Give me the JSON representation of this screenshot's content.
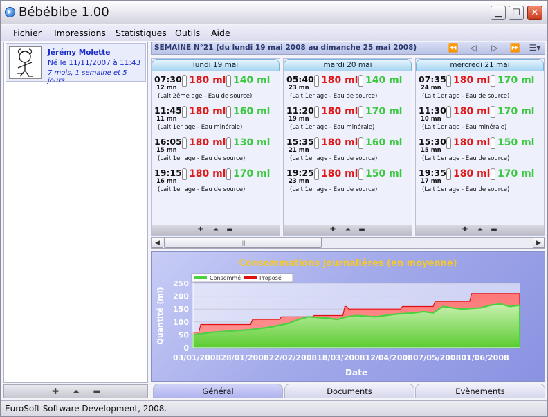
{
  "window": {
    "title": "Bébébibe 1.00",
    "icon": "app-icon"
  },
  "menu": [
    "Fichier",
    "Impressions",
    "Statistiques",
    "Outils",
    "Aide"
  ],
  "profile": {
    "name": "Jérémy Molette",
    "birth": "Né le 11/11/2007 à 11:43",
    "age": "7 mois, 1 semaine et 5 jours"
  },
  "week": {
    "label": "SEMAINE N°21 (du lundi 19 mai 2008 au dimanche 25 mai 2008)"
  },
  "days": [
    {
      "label": "lundi 19 mai",
      "meals": [
        {
          "time": "07:30",
          "duration": "12 mn",
          "proposed": "180 ml",
          "consumed": "140 ml",
          "note": "(Lait 2ème age - Eau de source)"
        },
        {
          "time": "11:45",
          "duration": "11 mn",
          "proposed": "180 ml",
          "consumed": "160 ml",
          "note": "(Lait 1er age - Eau minérale)"
        },
        {
          "time": "16:05",
          "duration": "15 mn",
          "proposed": "180 ml",
          "consumed": "130 ml",
          "note": "(Lait 1er age - Eau de source)"
        },
        {
          "time": "19:15",
          "duration": "16 mn",
          "proposed": "180 ml",
          "consumed": "170 ml",
          "note": "(Lait 1er age - Eau de source)"
        }
      ]
    },
    {
      "label": "mardi 20 mai",
      "meals": [
        {
          "time": "05:40",
          "duration": "23 mn",
          "proposed": "180 ml",
          "consumed": "140 ml",
          "note": "(Lait 1er age - Eau de source)"
        },
        {
          "time": "11:20",
          "duration": "19 mn",
          "proposed": "180 ml",
          "consumed": "170 ml",
          "note": "(Lait 1er age - Eau minérale)"
        },
        {
          "time": "15:35",
          "duration": "21 mn",
          "proposed": "180 ml",
          "consumed": "160 ml",
          "note": "(Lait 1er age - Eau de source)"
        },
        {
          "time": "19:25",
          "duration": "23 mn",
          "proposed": "180 ml",
          "consumed": "150 ml",
          "note": "(Lait 1er age - Eau de source)"
        }
      ]
    },
    {
      "label": "mercredi 21 mai",
      "meals": [
        {
          "time": "07:35",
          "duration": "24 mn",
          "proposed": "180 ml",
          "consumed": "170 ml",
          "note": "(Lait 1er age - Eau de source)"
        },
        {
          "time": "11:30",
          "duration": "10 mn",
          "proposed": "180 ml",
          "consumed": "170 ml",
          "note": "(Lait 1er age - Eau minérale)"
        },
        {
          "time": "15:30",
          "duration": "15 mn",
          "proposed": "180 ml",
          "consumed": "150 ml",
          "note": "(Lait 1er age - Eau de source)"
        },
        {
          "time": "19:35",
          "duration": "17 mn",
          "proposed": "180 ml",
          "consumed": "170 ml",
          "note": "(Lait 1er age - Eau de source)"
        }
      ]
    }
  ],
  "tabs": [
    "Général",
    "Documents",
    "Evènements"
  ],
  "status": "EuroSoft Software Development, 2008.",
  "chart_data": {
    "type": "area",
    "title": "Consommations journalières (en moyenne)",
    "xlabel": "Date",
    "ylabel": "Quantité (ml)",
    "ylim": [
      0,
      250
    ],
    "yticks": [
      0,
      50,
      100,
      150,
      200,
      250
    ],
    "xtick_labels": [
      "03/01/2008",
      "28/01/2008",
      "22/02/2008",
      "18/03/2008",
      "12/04/2008",
      "07/05/2008",
      "01/06/2008"
    ],
    "xtick_days": [
      2,
      27,
      52,
      77,
      102,
      127,
      152
    ],
    "x_range_days": [
      0,
      170
    ],
    "grid": true,
    "legend_position": "top-left",
    "series": [
      {
        "name": "Consommé",
        "color": "#4cd040",
        "x": [
          0,
          5,
          10,
          20,
          30,
          40,
          50,
          55,
          60,
          70,
          75,
          80,
          85,
          95,
          100,
          105,
          115,
          120,
          125,
          130,
          140,
          150,
          155,
          160,
          165,
          170
        ],
        "values": [
          50,
          55,
          60,
          65,
          70,
          80,
          95,
          110,
          120,
          115,
          110,
          120,
          125,
          120,
          125,
          130,
          135,
          140,
          135,
          160,
          150,
          155,
          165,
          170,
          160,
          165
        ]
      },
      {
        "name": "Proposé",
        "color": "#e01010",
        "x": [
          0,
          3,
          4,
          30,
          31,
          45,
          46,
          62,
          63,
          78,
          79,
          80,
          81,
          108,
          109,
          125,
          126,
          144,
          145,
          170
        ],
        "values": [
          60,
          60,
          90,
          90,
          110,
          110,
          120,
          120,
          125,
          125,
          160,
          160,
          150,
          150,
          160,
          160,
          180,
          180,
          210,
          210
        ]
      }
    ]
  }
}
